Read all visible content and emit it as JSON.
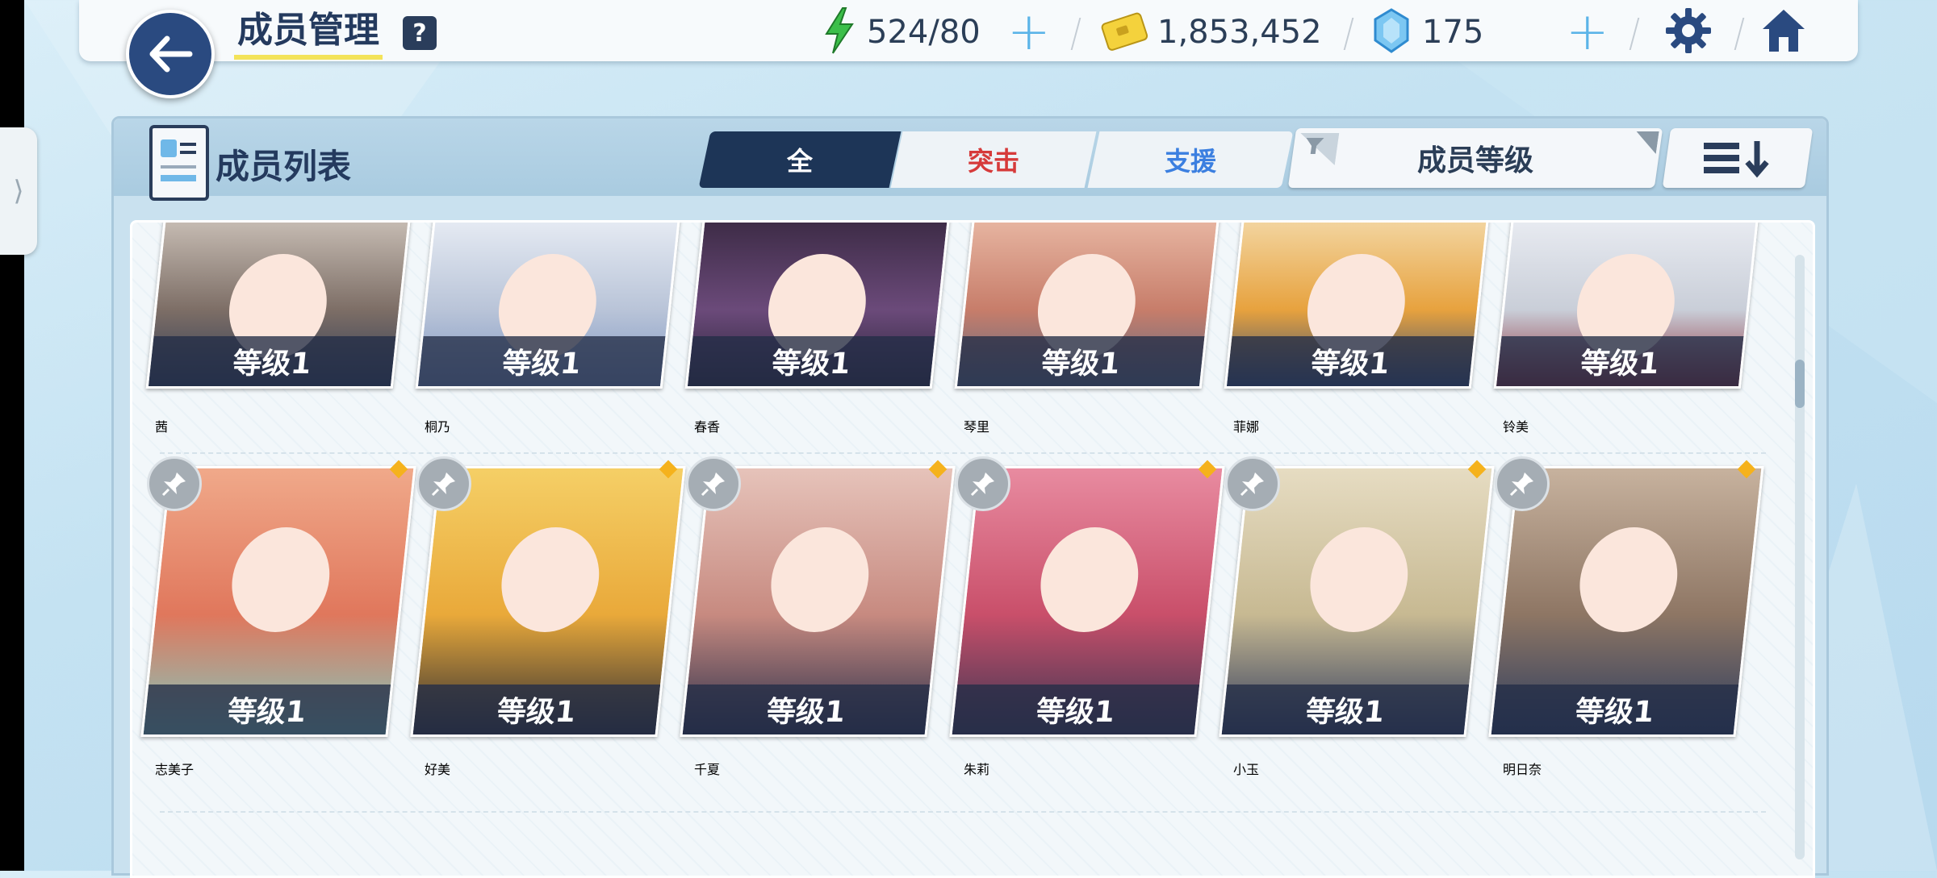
{
  "header": {
    "title": "成员管理",
    "help_label": "?",
    "ap": "524/80",
    "credits": "1,853,452",
    "gems": "175"
  },
  "panel": {
    "title": "成员列表",
    "tabs": [
      {
        "label": "全",
        "active": true
      },
      {
        "label": "突击",
        "color": "#d63a3a"
      },
      {
        "label": "支援",
        "color": "#3b7fe0"
      }
    ],
    "filter_label": "成员等级"
  },
  "members": [
    {
      "name": "茜",
      "level": "等级1",
      "palette": [
        "#c9bfb6",
        "#7d6e66",
        "#2e3b55"
      ]
    },
    {
      "name": "桐乃",
      "level": "等级1",
      "palette": [
        "#e7ecf4",
        "#b9c4d8",
        "#7e96c2"
      ]
    },
    {
      "name": "春香",
      "level": "等级1",
      "palette": [
        "#3b2a44",
        "#6b4a7a",
        "#2a2438"
      ]
    },
    {
      "name": "琴里",
      "level": "等级1",
      "palette": [
        "#e8b7a3",
        "#c77d6a",
        "#5a6b86"
      ]
    },
    {
      "name": "菲娜",
      "level": "等级1",
      "palette": [
        "#f3d7a4",
        "#e7a23e",
        "#2f4a7a"
      ]
    },
    {
      "name": "铃美",
      "level": "等级1",
      "palette": [
        "#e9ecf2",
        "#c9ced8",
        "#8b2430"
      ]
    },
    {
      "name": "志美子",
      "level": "等级1",
      "palette": [
        "#f0a98a",
        "#e0775c",
        "#7fc9c0"
      ]
    },
    {
      "name": "好美",
      "level": "等级1",
      "palette": [
        "#f5cf66",
        "#e9a93a",
        "#2b2b33"
      ]
    },
    {
      "name": "千夏",
      "level": "等级1",
      "palette": [
        "#e6c3ba",
        "#c78a80",
        "#2a2e4a"
      ]
    },
    {
      "name": "朱莉",
      "level": "等级1",
      "palette": [
        "#e88ba0",
        "#c94f6a",
        "#3a3552"
      ]
    },
    {
      "name": "小玉",
      "level": "等级1",
      "palette": [
        "#e6dcc2",
        "#c7b992",
        "#2f3a5c"
      ]
    },
    {
      "name": "明日奈",
      "level": "等级1",
      "palette": [
        "#c7b29e",
        "#8e7664",
        "#2a3b5e"
      ]
    }
  ],
  "colors": {
    "accent": "#2a4a80",
    "tab_active": "#1d3557",
    "highlight": "#f3e35a",
    "pin_dot": "#f5b21c"
  }
}
